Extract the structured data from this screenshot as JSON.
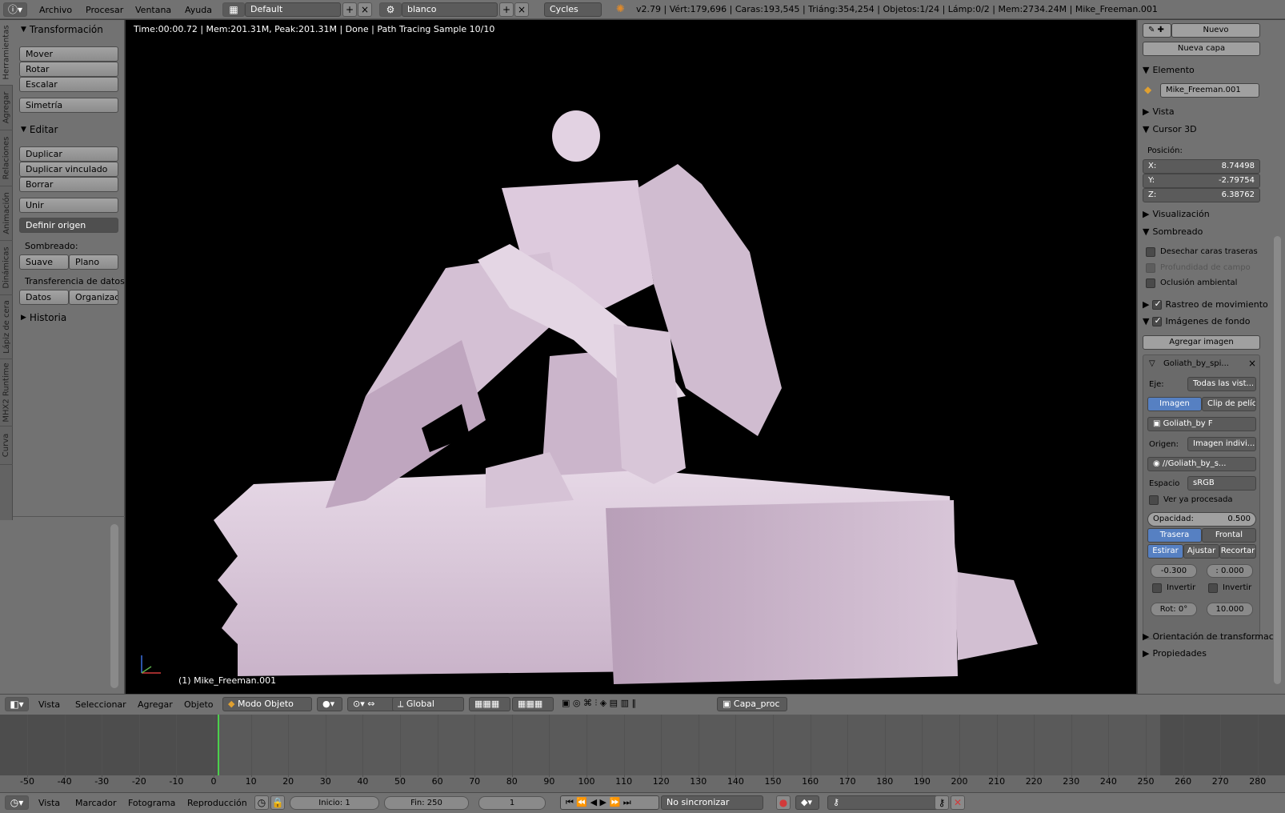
{
  "topbar": {
    "menus": [
      "Archivo",
      "Procesar",
      "Ventana",
      "Ayuda"
    ],
    "screen_layout": "Default",
    "scene": "blanco",
    "render_engine": "Cycles",
    "stats": "v2.79 | Vért:179,696 | Caras:193,545 | Triáng:354,254 | Objetos:1/24 | Lámp:0/2 | Mem:2734.24M | Mike_Freeman.001"
  },
  "vertical_tabs": [
    "Herramientas",
    "Agregar",
    "Relaciones",
    "Animación",
    "Dinámicas",
    "Lápiz de cera",
    "MHX2 Runtime",
    "Curva"
  ],
  "toolshelf": {
    "transform_header": "Transformación",
    "mover": "Mover",
    "rotar": "Rotar",
    "escalar": "Escalar",
    "simetria": "Simetría",
    "edit_header": "Editar",
    "duplicar": "Duplicar",
    "duplicar_vinculado": "Duplicar vinculado",
    "borrar": "Borrar",
    "unir": "Unir",
    "definir_origen": "Definir origen",
    "sombreado_label": "Sombreado:",
    "suave": "Suave",
    "plano": "Plano",
    "transfer_label": "Transferencia de datos:",
    "datos": "Datos",
    "organizar": "Organizaci",
    "historia_header": "Historia"
  },
  "viewport": {
    "render_info": "Time:00:00.72 | Mem:201.31M, Peak:201.31M | Done | Path Tracing Sample 10/10",
    "object_label": "(1) Mike_Freeman.001"
  },
  "properties": {
    "nuevo": "Nuevo",
    "nueva_capa": "Nueva capa",
    "elemento_header": "Elemento",
    "object_name": "Mike_Freeman.001",
    "vista_header": "Vista",
    "cursor_header": "Cursor 3D",
    "posicion_label": "Posición:",
    "x_label": "X:",
    "x_value": "8.74498",
    "y_label": "Y:",
    "y_value": "-2.79754",
    "z_label": "Z:",
    "z_value": "6.38762",
    "visualizacion_header": "Visualización",
    "sombreado_header": "Sombreado",
    "backface": "Desechar caras traseras",
    "dof": "Profundidad de campo",
    "ao": "Oclusión ambiental",
    "motion_tracking": "Rastreo de movimiento",
    "bg_images": "Imágenes de fondo",
    "add_image": "Agregar imagen",
    "image_name": "Goliath_by_spi...",
    "eje_label": "Eje:",
    "eje_value": "Todas las vist...",
    "imagen_tab": "Imagen",
    "clip_tab": "Clip de pelíc...",
    "image_field": "Goliath_by",
    "image_field_f": "F",
    "origen_label": "Origen:",
    "origen_value": "Imagen indivi...",
    "filepath": "//Goliath_by_s...",
    "espacio_label": "Espacio",
    "espacio_value": "sRGB",
    "ver_procesada": "Ver ya procesada",
    "opacidad_label": "Opacidad:",
    "opacidad_value": "0.500",
    "trasera": "Trasera",
    "frontal": "Frontal",
    "estirar": "Estirar",
    "ajustar": "Ajustar",
    "recortar": "Recortar",
    "offset_x": "-0.300",
    "offset_y": ": 0.000",
    "invertir1": "Invertir",
    "invertir2": "Invertir",
    "rot": "Rot: 0°",
    "size": "10.000",
    "orientacion_header": "Orientación de transformaci",
    "propiedades_header": "Propiedades"
  },
  "viewport_header": {
    "vista": "Vista",
    "seleccionar": "Seleccionar",
    "agregar": "Agregar",
    "objeto": "Objeto",
    "mode": "Modo Objeto",
    "orientation": "Global",
    "render_layer": "Capa_proc"
  },
  "timeline": {
    "ticks": [
      "-50",
      "-40",
      "-30",
      "-20",
      "-10",
      "0",
      "10",
      "20",
      "30",
      "40",
      "50",
      "60",
      "70",
      "80",
      "90",
      "100",
      "110",
      "120",
      "130",
      "140",
      "150",
      "160",
      "170",
      "180",
      "190",
      "200",
      "210",
      "220",
      "230",
      "240",
      "250",
      "260",
      "270",
      "280"
    ],
    "current_frame_marker": 0
  },
  "timeline_header": {
    "vista": "Vista",
    "marcador": "Marcador",
    "fotograma": "Fotograma",
    "reproduccion": "Reproducción",
    "inicio_label": "Inicio:",
    "inicio_value": "1",
    "fin_label": "Fin:",
    "fin_value": "250",
    "current_frame": "1",
    "sync": "No sincronizar"
  }
}
